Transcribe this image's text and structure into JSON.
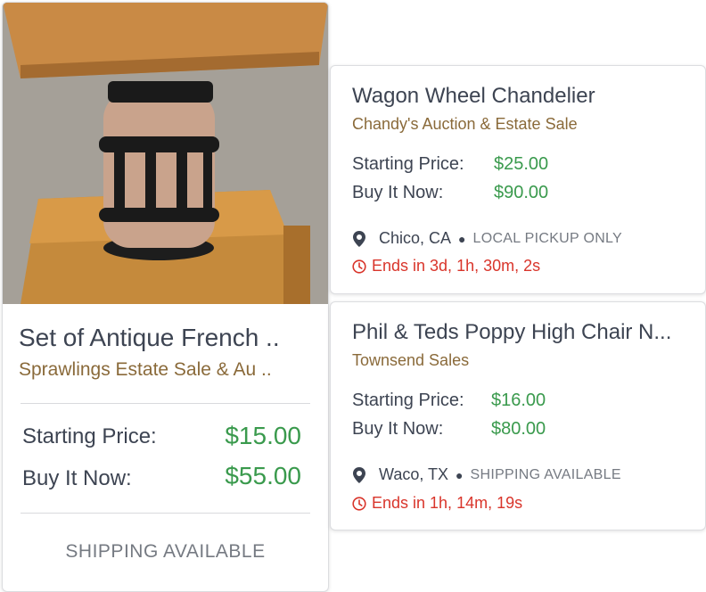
{
  "listings": [
    {
      "title": "Set of Antique French ..",
      "seller": "Sprawlings Estate Sale & Au ..",
      "starting_label": "Starting Price:",
      "starting_price": "$15.00",
      "buynow_label": "Buy It Now:",
      "buynow_price": "$55.00",
      "shipping": "SHIPPING AVAILABLE"
    },
    {
      "title": "Wagon Wheel Chandelier",
      "seller": "Chandy's Auction & Estate Sale",
      "starting_label": "Starting Price:",
      "starting_price": "$25.00",
      "buynow_label": "Buy It Now:",
      "buynow_price": "$90.00",
      "location": "Chico, CA",
      "shipping": "LOCAL PICKUP ONLY",
      "ends": "Ends in 3d, 1h, 30m, 2s"
    },
    {
      "title": "Phil & Teds Poppy High Chair N...",
      "seller": "Townsend Sales",
      "starting_label": "Starting Price:",
      "starting_price": "$16.00",
      "buynow_label": "Buy It Now:",
      "buynow_price": "$80.00",
      "location": "Waco, TX",
      "shipping": "SHIPPING AVAILABLE",
      "ends": "Ends in 1h, 14m, 19s"
    }
  ],
  "colors": {
    "price": "#3a9a4d",
    "seller": "#8a6a3a",
    "ends": "#d9352b"
  },
  "icons": {
    "location": "map-pin-icon",
    "time": "clock-icon"
  }
}
